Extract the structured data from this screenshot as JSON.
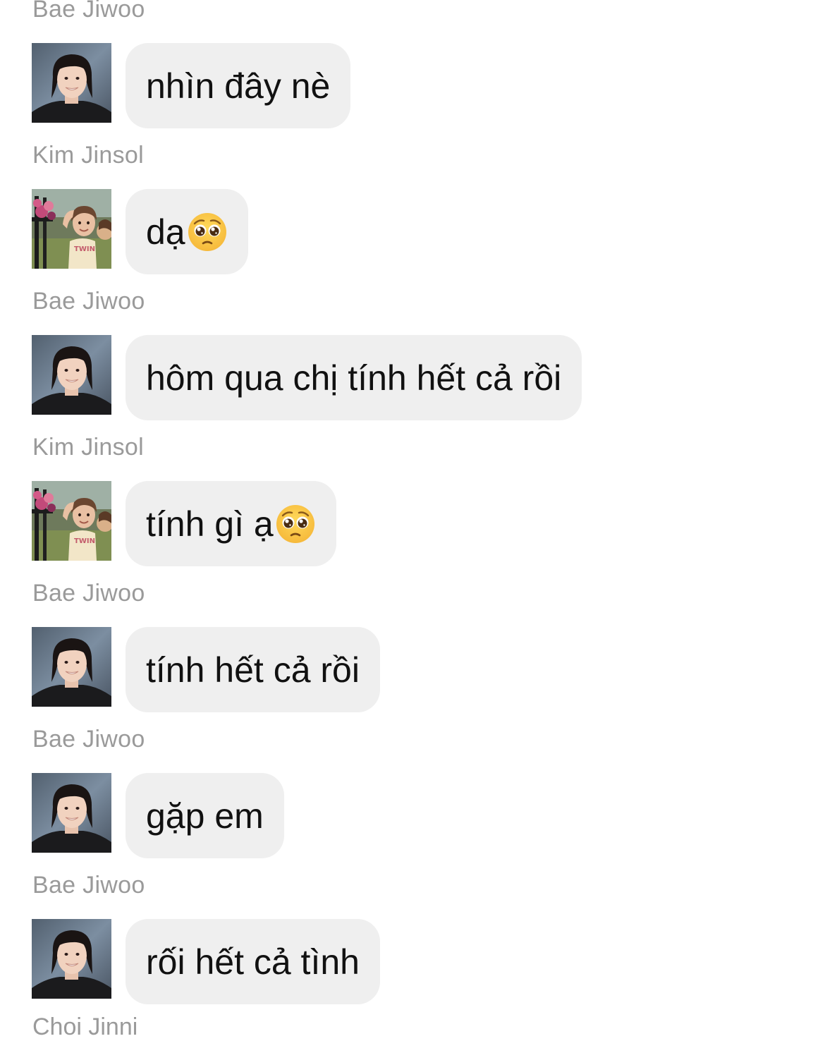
{
  "messages": [
    {
      "sender": "Bae Jiwoo",
      "text": "nhìn đây nè",
      "emoji": "",
      "avatar": "bae-jiwoo-avatar"
    },
    {
      "sender": "Kim Jinsol",
      "text": "dạ",
      "emoji": "pleading-face-icon",
      "avatar": "kim-jinsol-avatar"
    },
    {
      "sender": "Bae Jiwoo",
      "text": "hôm qua chị tính hết cả rồi",
      "emoji": "",
      "avatar": "bae-jiwoo-avatar"
    },
    {
      "sender": "Kim Jinsol",
      "text": "tính gì ạ",
      "emoji": "pleading-face-icon",
      "avatar": "kim-jinsol-avatar"
    },
    {
      "sender": "Bae Jiwoo",
      "text": "tính hết cả rồi",
      "emoji": "",
      "avatar": "bae-jiwoo-avatar"
    },
    {
      "sender": "Bae Jiwoo",
      "text": "gặp em",
      "emoji": "",
      "avatar": "bae-jiwoo-avatar"
    },
    {
      "sender": "Bae Jiwoo",
      "text": "rối hết cả tình",
      "emoji": "",
      "avatar": "bae-jiwoo-avatar"
    }
  ],
  "next_sender": "Choi Jinni",
  "colors": {
    "bubble": "#efefef",
    "sender_name": "#9a9a9a",
    "text": "#111111"
  }
}
